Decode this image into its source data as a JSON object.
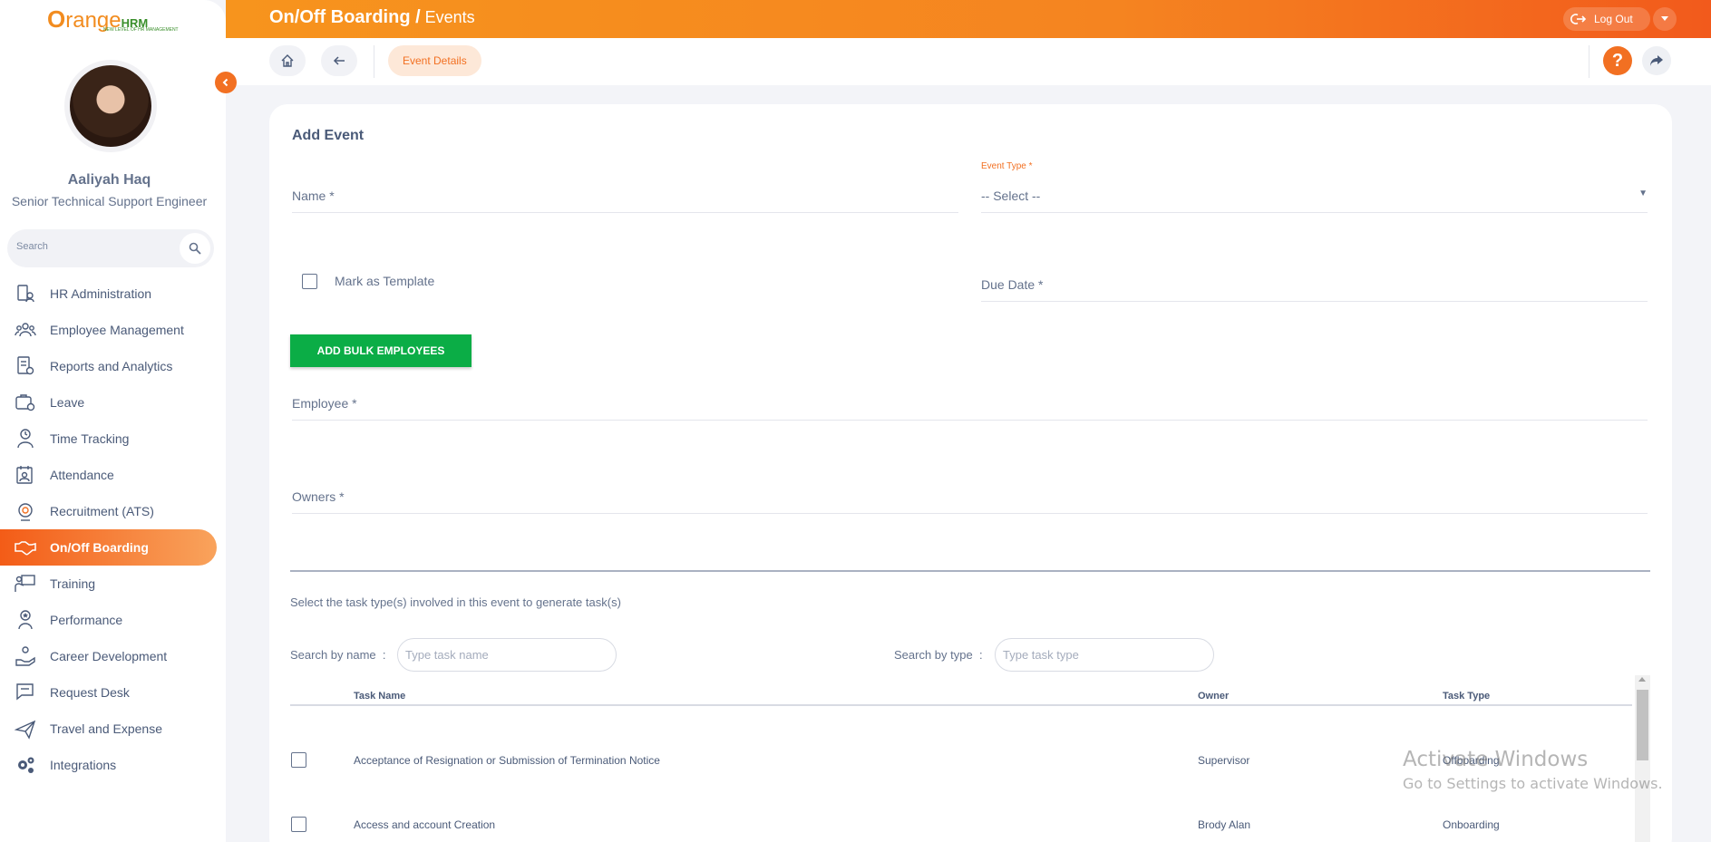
{
  "brand": {
    "logo_main": "range",
    "logo_o": "O",
    "logo_hrm": "HRM",
    "logo_tag": "NEW LEVEL OF HR MANAGEMENT"
  },
  "user": {
    "name": "Aaliyah Haq",
    "role": "Senior Technical Support Engineer"
  },
  "sidebar": {
    "search_placeholder": "Search",
    "items": [
      {
        "label": "HR Administration",
        "icon": "hr-admin-icon"
      },
      {
        "label": "Employee Management",
        "icon": "employees-icon"
      },
      {
        "label": "Reports and Analytics",
        "icon": "reports-icon"
      },
      {
        "label": "Leave",
        "icon": "leave-icon"
      },
      {
        "label": "Time Tracking",
        "icon": "time-icon"
      },
      {
        "label": "Attendance",
        "icon": "attendance-icon"
      },
      {
        "label": "Recruitment (ATS)",
        "icon": "recruitment-icon"
      },
      {
        "label": "On/Off Boarding",
        "icon": "handshake-icon",
        "active": true
      },
      {
        "label": "Training",
        "icon": "training-icon"
      },
      {
        "label": "Performance",
        "icon": "performance-icon"
      },
      {
        "label": "Career Development",
        "icon": "career-icon"
      },
      {
        "label": "Request Desk",
        "icon": "request-icon"
      },
      {
        "label": "Travel and Expense",
        "icon": "plane-icon"
      },
      {
        "label": "Integrations",
        "icon": "gears-icon"
      }
    ]
  },
  "header": {
    "title": "On/Off Boarding /",
    "subtitle": " Events",
    "logout_label": "Log Out"
  },
  "subnav": {
    "tab_label": "Event Details"
  },
  "form": {
    "title": "Add Event",
    "name_label": "Name",
    "event_type_label": "Event Type *",
    "event_type_value": "-- Select --",
    "mark_template_label": "Mark as Template",
    "due_date_label": "Due Date",
    "bulk_button": "ADD BULK EMPLOYEES",
    "employee_label": "Employee",
    "owners_label": "Owners",
    "required_mark": "*",
    "hint": "Select the task type(s) involved in this event to generate task(s)",
    "search_name_label": "Search by name",
    "search_name_placeholder": "Type task name",
    "search_type_label": "Search by type",
    "search_type_placeholder": "Type task type",
    "colon": ":"
  },
  "table": {
    "columns": {
      "name": "Task Name",
      "owner": "Owner",
      "type": "Task Type"
    },
    "rows": [
      {
        "name": "Acceptance of Resignation or Submission of Termination Notice",
        "owner": "Supervisor",
        "type": "Offboarding"
      },
      {
        "name": "Access and account Creation",
        "owner": "Brody Alan",
        "type": "Onboarding"
      }
    ]
  },
  "watermark": {
    "line1": "Activate Windows",
    "line2": "Go to Settings to activate Windows."
  },
  "colors": {
    "accent": "#f27022",
    "green": "#0bad46",
    "text": "#64728c"
  }
}
